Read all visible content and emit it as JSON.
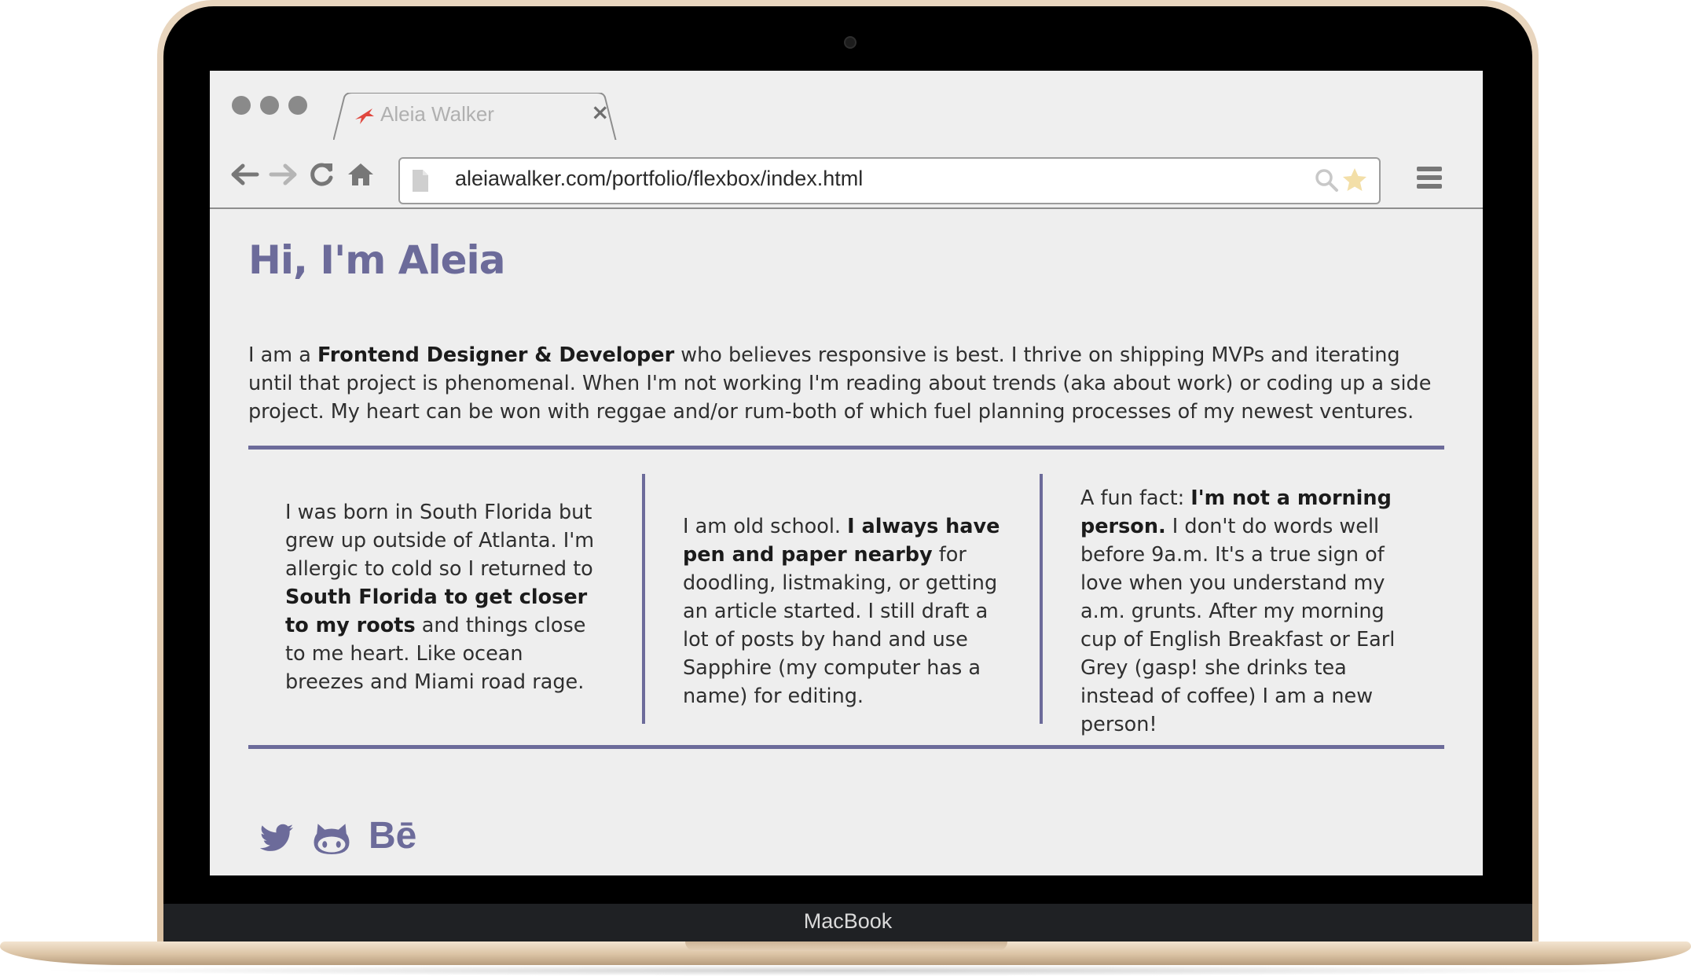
{
  "device": {
    "brand_label": "MacBook"
  },
  "browser": {
    "tab": {
      "title": "Aleia Walker"
    },
    "address_bar": {
      "url": "aleiawalker.com/portfolio/flexbox/index.html"
    }
  },
  "page": {
    "title": "Hi, I'm Aleia",
    "intro": {
      "before": "I am a ",
      "strong": "Frontend Designer & Developer",
      "after": " who believes responsive is best. I thrive on shipping MVPs and iterating until that project is phenomenal. When I'm not working I'm reading about trends (aka about work) or coding up a side project. My heart can be won with reggae and/or rum-both of which fuel planning processes of my newest ventures."
    },
    "columns": [
      {
        "before": "I was born in South Florida but grew up outside of Atlanta. I'm allergic to cold so I returned to ",
        "strong": "South Florida to get closer to my roots",
        "after": " and things close to me heart. Like ocean breezes and Miami road rage."
      },
      {
        "before": "I am old school. ",
        "strong": "I always have pen and paper nearby",
        "after": " for doodling, listmaking, or getting an article started. I still draft a lot of posts by hand and use Sapphire (my computer has a name) for editing."
      },
      {
        "before": "A fun fact: ",
        "strong": "I'm not a morning person.",
        "after": " I don't do words well before 9a.m. It's a true sign of love when you understand my a.m. grunts. After my morning cup of English Breakfast or Earl Grey (gasp! she drinks tea instead of coffee) I am a new person!"
      }
    ],
    "social": {
      "icons": [
        "twitter-icon",
        "github-icon",
        "behance-icon"
      ],
      "behance_text": "Bē"
    }
  },
  "colors": {
    "accent": "#6c6b9a",
    "text": "#2f2f2f",
    "page_bg": "#eeeeee",
    "tab_icon": "#e0473e",
    "star": "#f3dfa8"
  }
}
